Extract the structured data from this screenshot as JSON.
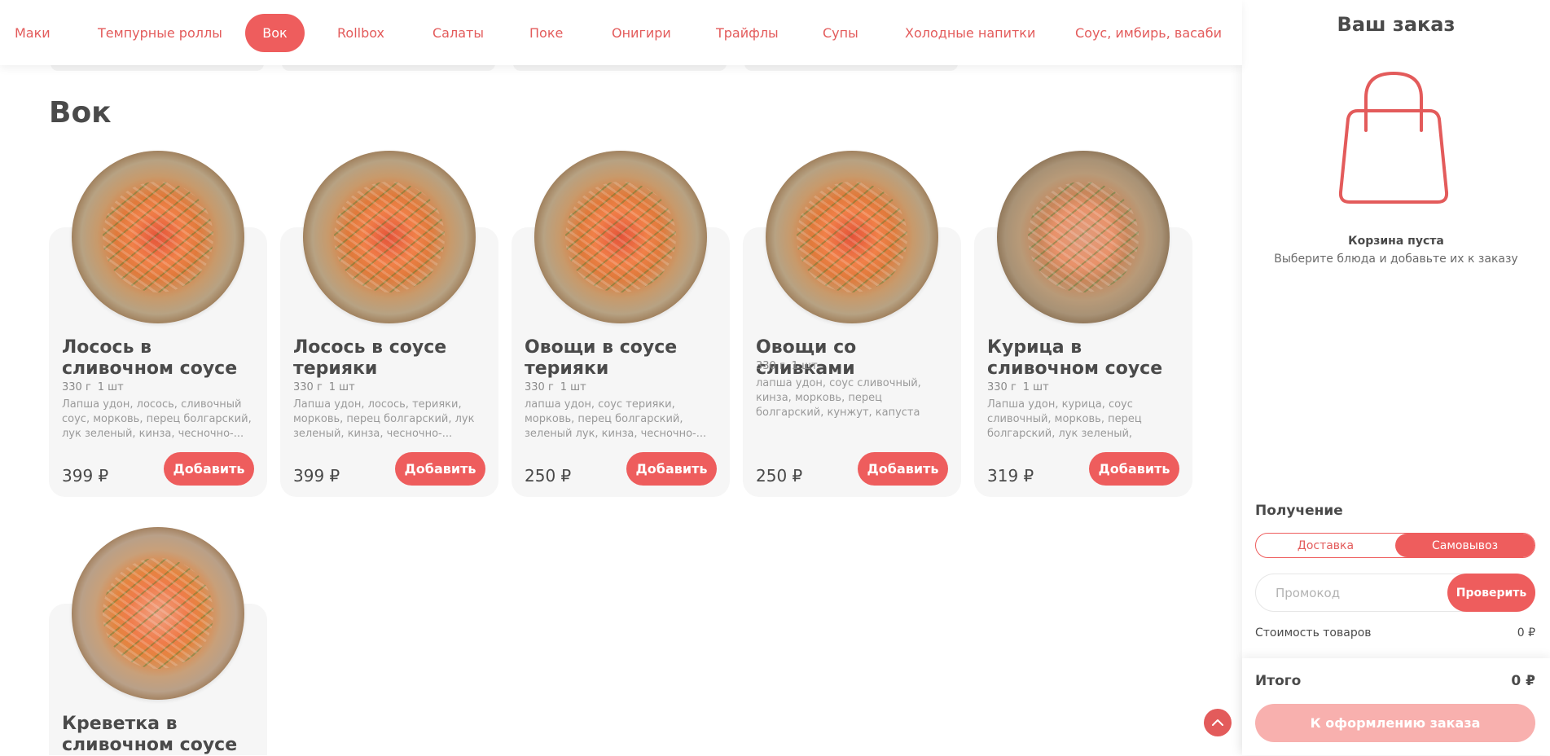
{
  "nav": {
    "items": [
      {
        "label": "Маки"
      },
      {
        "label": "Темпурные роллы"
      },
      {
        "label": "Вок",
        "active": true
      },
      {
        "label": "Rollbox"
      },
      {
        "label": "Салаты"
      },
      {
        "label": "Поке"
      },
      {
        "label": "Онигири"
      },
      {
        "label": "Трайфлы"
      },
      {
        "label": "Супы"
      },
      {
        "label": "Холодные напитки"
      },
      {
        "label": "Соус, имбирь, васаби"
      }
    ]
  },
  "section": {
    "title": "Вок"
  },
  "products": [
    {
      "name": "Лосось в сливочном соусе",
      "weight": "330 г",
      "count": "1 шт",
      "description": "Лапша удон, лосось, сливочный соус, морковь, перец болгарский, лук зеленый, кинза, чесночно-...",
      "price": "399 ₽",
      "button": "Добавить"
    },
    {
      "name": "Лосось в соусе терияки",
      "weight": "330 г",
      "count": "1 шт",
      "description": "Лапша удон, лосось, терияки, морковь, перец болгарский, лук зеленый, кинза, чесночно-...",
      "price": "399 ₽",
      "button": "Добавить"
    },
    {
      "name": "Овощи в соусе терияки",
      "weight": "330 г",
      "count": "1 шт",
      "description": "лапша удон, соус терияки, морковь, перец болгарский, зеленый лук, кинза, чесночно-...",
      "price": "250 ₽",
      "button": "Добавить"
    },
    {
      "name": "Овощи со сливками",
      "weight": "330 г",
      "count": "1 шт",
      "description": "лапша удон, соус сливочный, кинза, морковь, перец болгарский, кунжут, капуста пекинская,...",
      "price": "250 ₽",
      "button": "Добавить"
    },
    {
      "name": "Курица в сливочном соусе",
      "weight": "330 г",
      "count": "1 шт",
      "description": "Лапша удон, курица, соус сливочный, морковь, перец болгарский, лук зеленый, кинза,...",
      "price": "319 ₽",
      "button": "Добавить"
    },
    {
      "name": "Креветка в сливочном соусе"
    }
  ],
  "order": {
    "title": "Ваш заказ",
    "empty_title": "Корзина пуста",
    "empty_subtitle": "Выберите блюда и добавьте их к заказу",
    "receive_label": "Получение",
    "delivery_option": "Доставка",
    "pickup_option": "Самовывоз",
    "selected_option": "Самовывоз",
    "promo_placeholder": "Промокод",
    "promo_value": "",
    "check_button": "Проверить",
    "goods_cost_label": "Стоимость товаров",
    "goods_cost_value": "0 ₽",
    "total_label": "Итого",
    "total_value": "0 ₽",
    "checkout_button": "К оформлению заказа"
  },
  "colors": {
    "accent": "#ee5d5d",
    "accent_text": "#e35b5b",
    "checkout_disabled": "#f8b0ae",
    "card_bg": "#f6f6f6"
  },
  "icons": {
    "bag": "shopping-bag-icon",
    "scroll_top": "chevron-up-icon"
  }
}
